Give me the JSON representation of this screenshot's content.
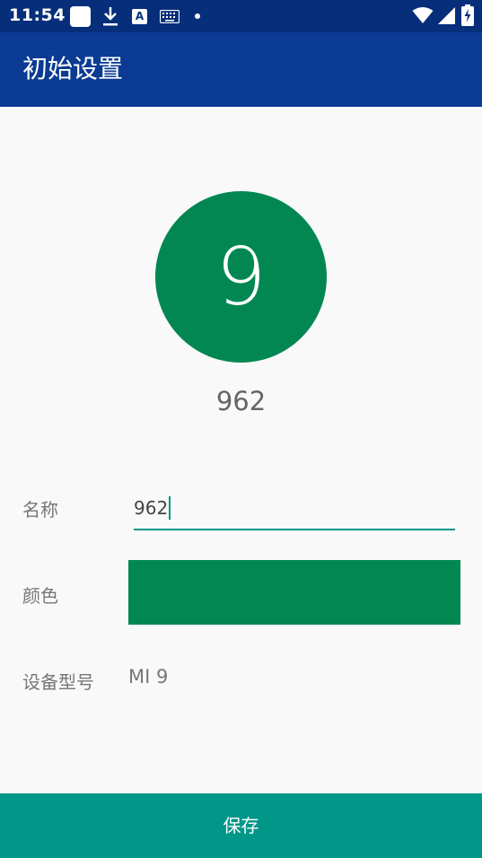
{
  "status_bar": {
    "time": "11:54",
    "notification_icons": [
      "app-square-icon",
      "download-icon",
      "a-text-icon",
      "keyboard-icon",
      "dot-icon"
    ],
    "system_icons": [
      "wifi-icon",
      "signal-icon",
      "battery-charging-icon"
    ],
    "a_icon_text": "A"
  },
  "app_bar": {
    "title": "初始设置"
  },
  "profile": {
    "avatar_initial": "9",
    "avatar_color": "#028753",
    "device_name": "962"
  },
  "form": {
    "name_label": "名称",
    "name_value": "962",
    "color_label": "颜色",
    "color_value": "#028753",
    "model_label": "设备型号",
    "model_value": "MI 9"
  },
  "actions": {
    "save_label": "保存"
  },
  "colors": {
    "status_bar": "#072e7a",
    "app_bar": "#0b3b93",
    "accent": "#009688",
    "background": "#f9f9f9"
  }
}
